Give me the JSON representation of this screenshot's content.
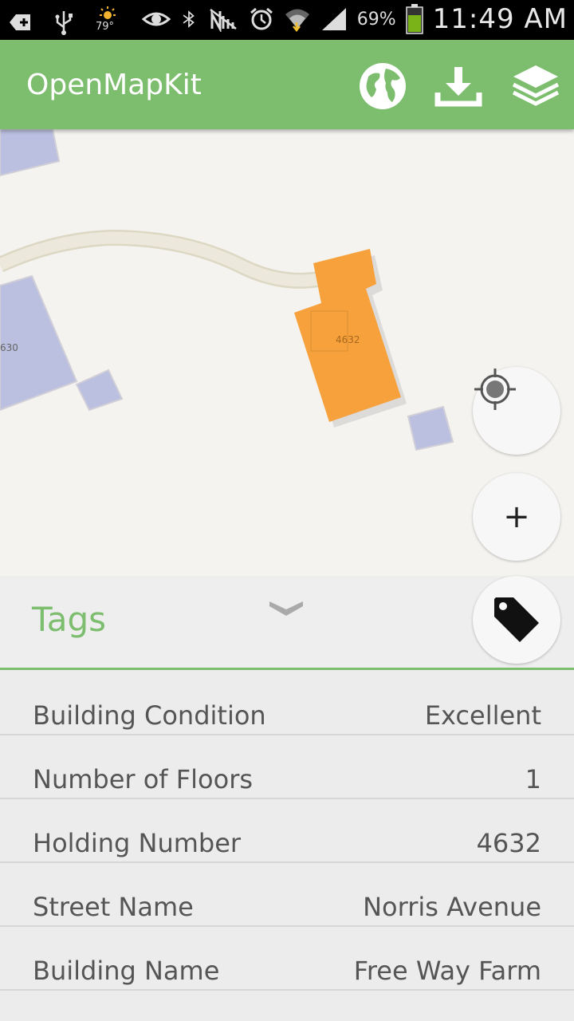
{
  "status_bar": {
    "temperature": "79°",
    "battery_percent": "69%",
    "time": "11:49 AM",
    "icons": [
      "add-notification-icon",
      "usb-icon",
      "weather-sun-icon",
      "eye-icon",
      "bluetooth-icon",
      "no-signal-icon",
      "alarm-icon",
      "wifi-icon",
      "cell-signal-icon",
      "battery-icon"
    ]
  },
  "app_bar": {
    "title": "OpenMapKit",
    "actions": [
      "globe-icon",
      "download-icon",
      "layers-icon"
    ]
  },
  "map": {
    "labels": {
      "left_building": "630",
      "selected_building": "4632"
    },
    "colors": {
      "background": "#f5f3ef",
      "building": "#bbbfe0",
      "selected": "#f6a13c",
      "road": "#ece8dc"
    }
  },
  "tags": {
    "title": "Tags",
    "accent": "#7cbd6e",
    "rows": [
      {
        "key": "Building Condition",
        "value": "Excellent"
      },
      {
        "key": "Number of Floors",
        "value": "1"
      },
      {
        "key": "Holding Number",
        "value": "4632"
      },
      {
        "key": "Street Name",
        "value": "Norris Avenue"
      },
      {
        "key": "Building Name",
        "value": "Free Way Farm"
      }
    ]
  },
  "fabs": {
    "zoom_in_label": "+"
  }
}
